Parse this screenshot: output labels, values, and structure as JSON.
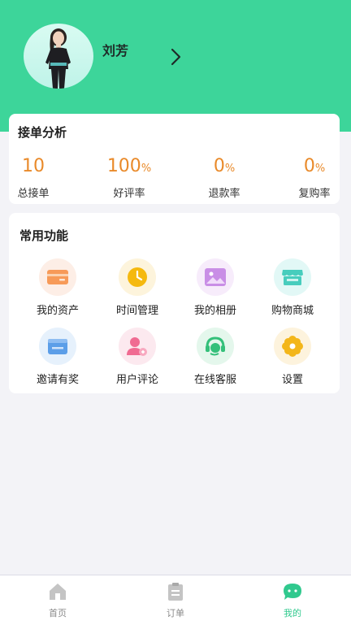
{
  "colors": {
    "brand": "#3dd59a",
    "stat_value": "#e98a2a",
    "tab_active": "#30c98e",
    "tab_inactive": "#bdbdbd"
  },
  "profile": {
    "name": "刘芳",
    "avatar_icon": "user-avatar-photo",
    "arrow_icon": "chevron-right-icon"
  },
  "stats": {
    "title": "接单分析",
    "items": [
      {
        "value": "10",
        "unit": "",
        "label": "总接单"
      },
      {
        "value": "100",
        "unit": "%",
        "label": "好评率"
      },
      {
        "value": "0",
        "unit": "%",
        "label": "退款率"
      },
      {
        "value": "0",
        "unit": "%",
        "label": "复购率"
      }
    ]
  },
  "functions": {
    "title": "常用功能",
    "items": [
      {
        "label": "我的资产",
        "icon": "wallet-icon"
      },
      {
        "label": "时间管理",
        "icon": "clock-icon"
      },
      {
        "label": "我的相册",
        "icon": "picture-icon"
      },
      {
        "label": "购物商城",
        "icon": "shop-icon"
      },
      {
        "label": "邀请有奖",
        "icon": "invite-icon"
      },
      {
        "label": "用户评论",
        "icon": "user-comment-icon"
      },
      {
        "label": "在线客服",
        "icon": "headset-icon"
      },
      {
        "label": "设置",
        "icon": "gear-icon"
      }
    ]
  },
  "tabbar": {
    "items": [
      {
        "label": "首页",
        "icon": "home-icon",
        "active": false
      },
      {
        "label": "订单",
        "icon": "clipboard-icon",
        "active": false
      },
      {
        "label": "我的",
        "icon": "chat-bubble-icon",
        "active": true
      }
    ]
  }
}
